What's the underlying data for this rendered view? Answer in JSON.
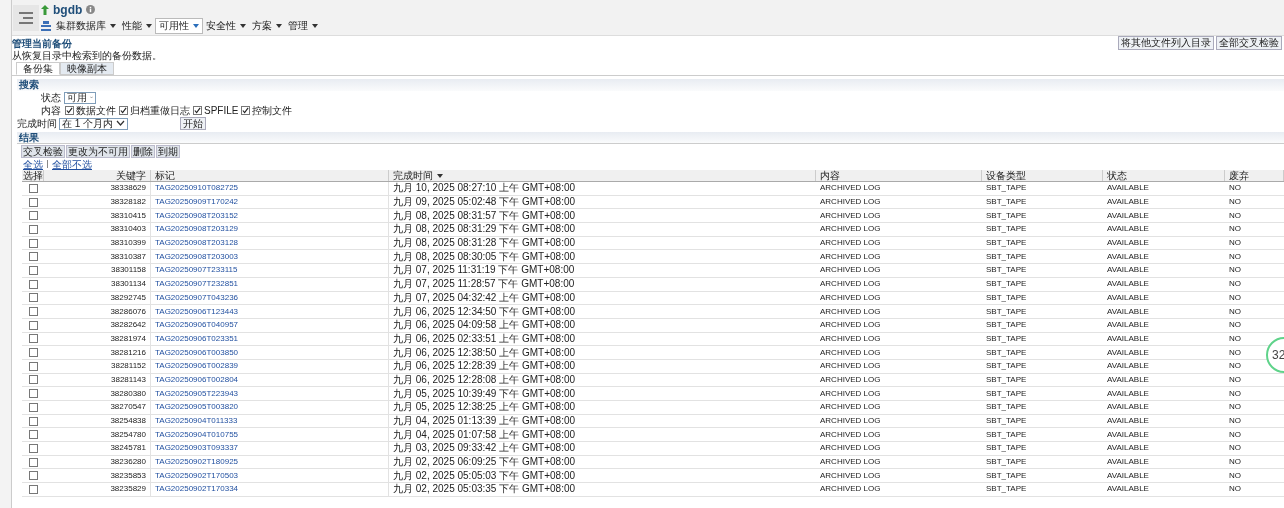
{
  "header": {
    "db_name": "bgdb",
    "menus": [
      {
        "label": "集群数据库",
        "selected": false
      },
      {
        "label": "性能",
        "selected": false
      },
      {
        "label": "可用性",
        "selected": true
      },
      {
        "label": "安全性",
        "selected": false
      },
      {
        "label": "方案",
        "selected": false
      },
      {
        "label": "管理",
        "selected": false
      }
    ]
  },
  "page_title": "管理当前备份",
  "top_actions": [
    "将其他文件列入目录",
    "全部交叉检验"
  ],
  "description": "从恢复目录中检索到的备份数据。",
  "tabs": [
    {
      "label": "备份集",
      "selected": true
    },
    {
      "label": "映像副本",
      "selected": false
    }
  ],
  "search": {
    "title": "搜索",
    "status_label": "状态",
    "status_value": "可用",
    "content_label": "内容",
    "content_options": [
      {
        "label": "数据文件",
        "checked": true
      },
      {
        "label": "归档重做日志",
        "checked": true
      },
      {
        "label": "SPFILE",
        "checked": true
      },
      {
        "label": "控制文件",
        "checked": true
      }
    ],
    "time_label": "完成时间",
    "time_value": "在 1 个月内",
    "go_button": "开始"
  },
  "results": {
    "title": "结果",
    "buttons": [
      "交叉检验",
      "更改为不可用",
      "删除",
      "到期"
    ],
    "select_all": "全选",
    "select_none": "全部不选",
    "columns": [
      {
        "label": "选择",
        "sorted": false
      },
      {
        "label": "关键字",
        "sorted": false
      },
      {
        "label": "标记",
        "sorted": false
      },
      {
        "label": "完成时间",
        "sorted": true
      },
      {
        "label": "内容",
        "sorted": false
      },
      {
        "label": "设备类型",
        "sorted": false
      },
      {
        "label": "状态",
        "sorted": false
      },
      {
        "label": "废弃",
        "sorted": false
      }
    ],
    "rows": [
      {
        "selected": false,
        "key": "38338629",
        "tag": "TAG20250910T082725",
        "time": "九月 10, 2025 08:27:10 上午 GMT+08:00",
        "content": "ARCHIVED LOG",
        "device": "SBT_TAPE",
        "status": "AVAILABLE",
        "obsolete": "NO"
      },
      {
        "selected": false,
        "key": "38328182",
        "tag": "TAG20250909T170242",
        "time": "九月 09, 2025 05:02:48 下午 GMT+08:00",
        "content": "ARCHIVED LOG",
        "device": "SBT_TAPE",
        "status": "AVAILABLE",
        "obsolete": "NO"
      },
      {
        "selected": false,
        "key": "38310415",
        "tag": "TAG20250908T203152",
        "time": "九月 08, 2025 08:31:57 下午 GMT+08:00",
        "content": "ARCHIVED LOG",
        "device": "SBT_TAPE",
        "status": "AVAILABLE",
        "obsolete": "NO"
      },
      {
        "selected": false,
        "key": "38310403",
        "tag": "TAG20250908T203129",
        "time": "九月 08, 2025 08:31:29 下午 GMT+08:00",
        "content": "ARCHIVED LOG",
        "device": "SBT_TAPE",
        "status": "AVAILABLE",
        "obsolete": "NO"
      },
      {
        "selected": false,
        "key": "38310399",
        "tag": "TAG20250908T203128",
        "time": "九月 08, 2025 08:31:28 下午 GMT+08:00",
        "content": "ARCHIVED LOG",
        "device": "SBT_TAPE",
        "status": "AVAILABLE",
        "obsolete": "NO"
      },
      {
        "selected": false,
        "key": "38310387",
        "tag": "TAG20250908T203003",
        "time": "九月 08, 2025 08:30:05 下午 GMT+08:00",
        "content": "ARCHIVED LOG",
        "device": "SBT_TAPE",
        "status": "AVAILABLE",
        "obsolete": "NO"
      },
      {
        "selected": false,
        "key": "38301158",
        "tag": "TAG20250907T233115",
        "time": "九月 07, 2025 11:31:19 下午 GMT+08:00",
        "content": "ARCHIVED LOG",
        "device": "SBT_TAPE",
        "status": "AVAILABLE",
        "obsolete": "NO"
      },
      {
        "selected": false,
        "key": "38301134",
        "tag": "TAG20250907T232851",
        "time": "九月 07, 2025 11:28:57 下午 GMT+08:00",
        "content": "ARCHIVED LOG",
        "device": "SBT_TAPE",
        "status": "AVAILABLE",
        "obsolete": "NO"
      },
      {
        "selected": false,
        "key": "38292745",
        "tag": "TAG20250907T043236",
        "time": "九月 07, 2025 04:32:42 上午 GMT+08:00",
        "content": "ARCHIVED LOG",
        "device": "SBT_TAPE",
        "status": "AVAILABLE",
        "obsolete": "NO"
      },
      {
        "selected": false,
        "key": "38286076",
        "tag": "TAG20250906T123443",
        "time": "九月 06, 2025 12:34:50 下午 GMT+08:00",
        "content": "ARCHIVED LOG",
        "device": "SBT_TAPE",
        "status": "AVAILABLE",
        "obsolete": "NO"
      },
      {
        "selected": false,
        "key": "38282642",
        "tag": "TAG20250906T040957",
        "time": "九月 06, 2025 04:09:58 上午 GMT+08:00",
        "content": "ARCHIVED LOG",
        "device": "SBT_TAPE",
        "status": "AVAILABLE",
        "obsolete": "NO"
      },
      {
        "selected": false,
        "key": "38281974",
        "tag": "TAG20250906T023351",
        "time": "九月 06, 2025 02:33:51 上午 GMT+08:00",
        "content": "ARCHIVED LOG",
        "device": "SBT_TAPE",
        "status": "AVAILABLE",
        "obsolete": "NO"
      },
      {
        "selected": false,
        "key": "38281216",
        "tag": "TAG20250906T003850",
        "time": "九月 06, 2025 12:38:50 上午 GMT+08:00",
        "content": "ARCHIVED LOG",
        "device": "SBT_TAPE",
        "status": "AVAILABLE",
        "obsolete": "NO"
      },
      {
        "selected": false,
        "key": "38281152",
        "tag": "TAG20250906T002839",
        "time": "九月 06, 2025 12:28:39 上午 GMT+08:00",
        "content": "ARCHIVED LOG",
        "device": "SBT_TAPE",
        "status": "AVAILABLE",
        "obsolete": "NO"
      },
      {
        "selected": false,
        "key": "38281143",
        "tag": "TAG20250906T002804",
        "time": "九月 06, 2025 12:28:08 上午 GMT+08:00",
        "content": "ARCHIVED LOG",
        "device": "SBT_TAPE",
        "status": "AVAILABLE",
        "obsolete": "NO"
      },
      {
        "selected": false,
        "key": "38280380",
        "tag": "TAG20250905T223943",
        "time": "九月 05, 2025 10:39:49 下午 GMT+08:00",
        "content": "ARCHIVED LOG",
        "device": "SBT_TAPE",
        "status": "AVAILABLE",
        "obsolete": "NO"
      },
      {
        "selected": false,
        "key": "38270547",
        "tag": "TAG20250905T003820",
        "time": "九月 05, 2025 12:38:25 上午 GMT+08:00",
        "content": "ARCHIVED LOG",
        "device": "SBT_TAPE",
        "status": "AVAILABLE",
        "obsolete": "NO"
      },
      {
        "selected": false,
        "key": "38254838",
        "tag": "TAG20250904T011333",
        "time": "九月 04, 2025 01:13:39 上午 GMT+08:00",
        "content": "ARCHIVED LOG",
        "device": "SBT_TAPE",
        "status": "AVAILABLE",
        "obsolete": "NO"
      },
      {
        "selected": false,
        "key": "38254780",
        "tag": "TAG20250904T010755",
        "time": "九月 04, 2025 01:07:58 上午 GMT+08:00",
        "content": "ARCHIVED LOG",
        "device": "SBT_TAPE",
        "status": "AVAILABLE",
        "obsolete": "NO"
      },
      {
        "selected": false,
        "key": "38245781",
        "tag": "TAG20250903T093337",
        "time": "九月 03, 2025 09:33:42 上午 GMT+08:00",
        "content": "ARCHIVED LOG",
        "device": "SBT_TAPE",
        "status": "AVAILABLE",
        "obsolete": "NO"
      },
      {
        "selected": false,
        "key": "38236280",
        "tag": "TAG20250902T180925",
        "time": "九月 02, 2025 06:09:25 下午 GMT+08:00",
        "content": "ARCHIVED LOG",
        "device": "SBT_TAPE",
        "status": "AVAILABLE",
        "obsolete": "NO"
      },
      {
        "selected": false,
        "key": "38235853",
        "tag": "TAG20250902T170503",
        "time": "九月 02, 2025 05:05:03 下午 GMT+08:00",
        "content": "ARCHIVED LOG",
        "device": "SBT_TAPE",
        "status": "AVAILABLE",
        "obsolete": "NO"
      },
      {
        "selected": false,
        "key": "38235829",
        "tag": "TAG20250902T170334",
        "time": "九月 02, 2025 05:03:35 下午 GMT+08:00",
        "content": "ARCHIVED LOG",
        "device": "SBT_TAPE",
        "status": "AVAILABLE",
        "obsolete": "NO"
      }
    ]
  },
  "floating_badge": {
    "value": "32"
  }
}
